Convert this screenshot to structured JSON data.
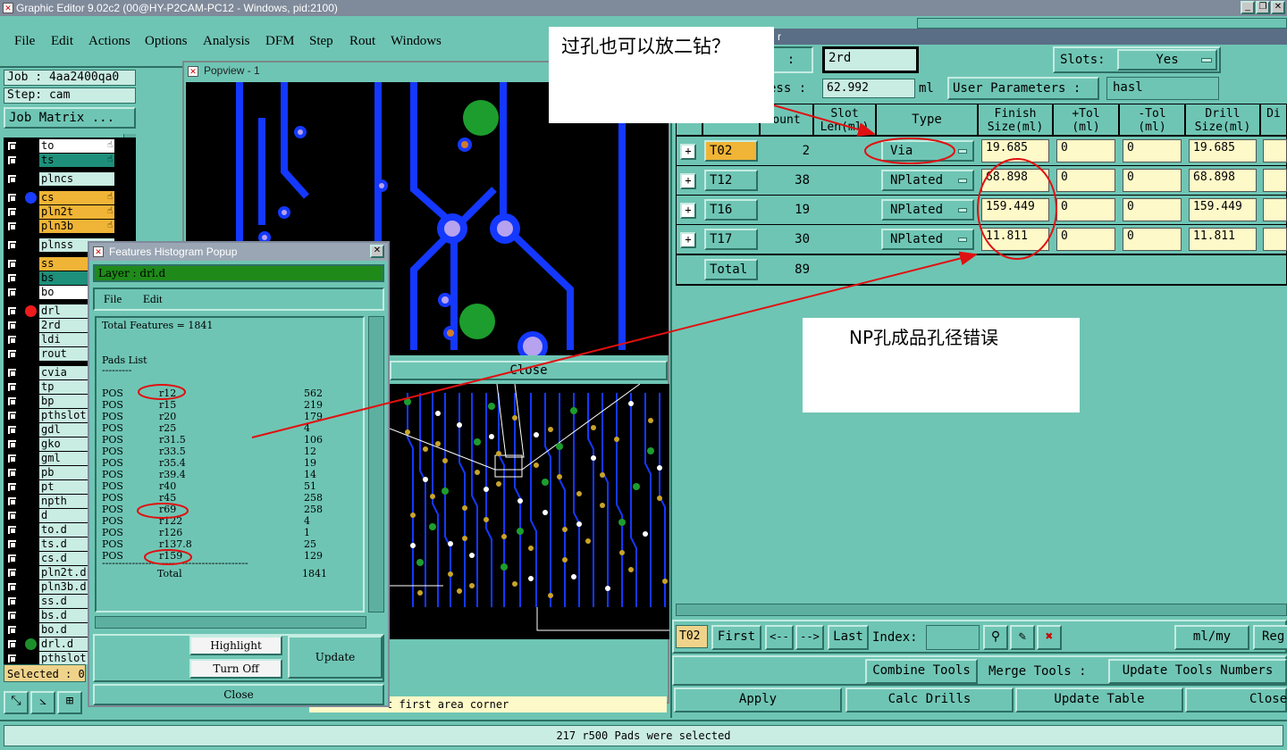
{
  "window": {
    "title": "Graphic Editor 9.02c2 (00@HY-P2CAM-PC12 - Windows, pid:2100)"
  },
  "menu": [
    "File",
    "Edit",
    "Actions",
    "Options",
    "Analysis",
    "DFM",
    "Step",
    "Rout",
    "Windows"
  ],
  "left_panel": {
    "job": "Job : 4aa2400qa0",
    "step": "Step: cam",
    "job_matrix": "Job Matrix ...",
    "selected": "Selected : 0"
  },
  "layers": [
    {
      "name": "to",
      "color": "#ffffff",
      "dot": "#000000",
      "hand": "☝"
    },
    {
      "name": "ts",
      "color": "#1d8f7a",
      "dot": "#000000",
      "hand": "☝"
    },
    {
      "name": "plncs",
      "color": "#c9ece3",
      "dot": "#000000",
      "hand": ""
    },
    {
      "name": "cs",
      "color": "#f0b436",
      "dot": "#1a3cff",
      "hand": "☝"
    },
    {
      "name": "pln2t",
      "color": "#f0b436",
      "dot": "#000000",
      "hand": "☝"
    },
    {
      "name": "pln3b",
      "color": "#f0b436",
      "dot": "#000000",
      "hand": "☝"
    },
    {
      "name": "plnss",
      "color": "#c9ece3",
      "dot": "#000000",
      "hand": ""
    },
    {
      "name": "ss",
      "color": "#f0b436",
      "dot": "#000000",
      "hand": ""
    },
    {
      "name": "bs",
      "color": "#1d8f7a",
      "dot": "#000000",
      "hand": ""
    },
    {
      "name": "bo",
      "color": "#ffffff",
      "dot": "#000000",
      "hand": ""
    },
    {
      "name": "drl",
      "color": "#c9ece3",
      "dot": "#ee1c1c",
      "hand": ""
    },
    {
      "name": "2rd",
      "color": "#c9ece3",
      "dot": "#000000",
      "hand": ""
    },
    {
      "name": "ldi",
      "color": "#c9ece3",
      "dot": "#000000",
      "hand": ""
    },
    {
      "name": "rout",
      "color": "#c9ece3",
      "dot": "#000000",
      "hand": ""
    },
    {
      "name": "cvia",
      "color": "#c9ece3",
      "dot": "#000000",
      "hand": ""
    },
    {
      "name": "tp",
      "color": "#c9ece3",
      "dot": "#000000",
      "hand": ""
    },
    {
      "name": "bp",
      "color": "#c9ece3",
      "dot": "#000000",
      "hand": ""
    },
    {
      "name": "pthslot",
      "color": "#c9ece3",
      "dot": "#000000",
      "hand": ""
    },
    {
      "name": "gdl",
      "color": "#c9ece3",
      "dot": "#000000",
      "hand": ""
    },
    {
      "name": "gko",
      "color": "#c9ece3",
      "dot": "#000000",
      "hand": ""
    },
    {
      "name": "gml",
      "color": "#c9ece3",
      "dot": "#000000",
      "hand": ""
    },
    {
      "name": "pb",
      "color": "#c9ece3",
      "dot": "#000000",
      "hand": ""
    },
    {
      "name": "pt",
      "color": "#c9ece3",
      "dot": "#000000",
      "hand": ""
    },
    {
      "name": "npth",
      "color": "#c9ece3",
      "dot": "#000000",
      "hand": ""
    },
    {
      "name": "d",
      "color": "#c9ece3",
      "dot": "#000000",
      "hand": ""
    },
    {
      "name": "to.d",
      "color": "#c9ece3",
      "dot": "#000000",
      "hand": ""
    },
    {
      "name": "ts.d",
      "color": "#c9ece3",
      "dot": "#000000",
      "hand": ""
    },
    {
      "name": "cs.d",
      "color": "#c9ece3",
      "dot": "#000000",
      "hand": ""
    },
    {
      "name": "pln2t.d",
      "color": "#c9ece3",
      "dot": "#000000",
      "hand": ""
    },
    {
      "name": "pln3b.d",
      "color": "#c9ece3",
      "dot": "#000000",
      "hand": ""
    },
    {
      "name": "ss.d",
      "color": "#c9ece3",
      "dot": "#000000",
      "hand": ""
    },
    {
      "name": "bs.d",
      "color": "#c9ece3",
      "dot": "#000000",
      "hand": ""
    },
    {
      "name": "bo.d",
      "color": "#c9ece3",
      "dot": "#000000",
      "hand": ""
    },
    {
      "name": "drl.d",
      "color": "#c9ece3",
      "dot": "#1d8f2a",
      "hand": ""
    },
    {
      "name": "pthslot.",
      "color": "#c9ece3",
      "dot": "#000000",
      "hand": ""
    }
  ],
  "popview": {
    "title": "Popview - 1",
    "close": "Close",
    "prompt": "t first area corner"
  },
  "histogram": {
    "title": "Features Histogram Popup",
    "layer": "Layer :  drl.d",
    "menu_file": "File",
    "menu_edit": "Edit",
    "total_features": "Total Features = 1841",
    "pads_list": "Pads List",
    "underline": "---------",
    "rows": [
      {
        "pol": "POS",
        "sym": "r12",
        "count": "562"
      },
      {
        "pol": "POS",
        "sym": "r15",
        "count": "219"
      },
      {
        "pol": "POS",
        "sym": "r20",
        "count": "179"
      },
      {
        "pol": "POS",
        "sym": "r25",
        "count": "4"
      },
      {
        "pol": "POS",
        "sym": "r31.5",
        "count": "106"
      },
      {
        "pol": "POS",
        "sym": "r33.5",
        "count": "12"
      },
      {
        "pol": "POS",
        "sym": "r35.4",
        "count": "19"
      },
      {
        "pol": "POS",
        "sym": "r39.4",
        "count": "14"
      },
      {
        "pol": "POS",
        "sym": "r40",
        "count": "51"
      },
      {
        "pol": "POS",
        "sym": "r45",
        "count": "258"
      },
      {
        "pol": "POS",
        "sym": "r69",
        "count": "258"
      },
      {
        "pol": "POS",
        "sym": "r122",
        "count": "4"
      },
      {
        "pol": "POS",
        "sym": "r126",
        "count": "1"
      },
      {
        "pol": "POS",
        "sym": "r137.8",
        "count": "25"
      },
      {
        "pol": "POS",
        "sym": "r159",
        "count": "129"
      }
    ],
    "total_label": "Total",
    "total_value": "1841",
    "highlight": "Highlight",
    "turn_off": "Turn Off",
    "update": "Update",
    "close": "Close"
  },
  "drill": {
    "title_suffix": "r",
    "colon": ":",
    "layer_value": "2rd",
    "thickness_label": "ess :",
    "thickness_value": "62.992",
    "thickness_unit": "ml",
    "slots_label": "Slots:",
    "slots_value": "Yes",
    "user_params_label": "User Parameters :",
    "user_params_value": "hasl",
    "headers": [
      "ount",
      "Slot\nLen(ml)",
      "Type",
      "Finish\nSize(ml)",
      "+Tol\n(ml)",
      "-Tol\n(ml)",
      "Drill\nSize(ml)",
      "Di\n"
    ],
    "rows": [
      {
        "tool": "T02",
        "count": "2",
        "type": "Via",
        "finish": "19.685",
        "ptol": "0",
        "mtol": "0",
        "drill": "19.685"
      },
      {
        "tool": "T12",
        "count": "38",
        "type": "NPlated",
        "finish": "68.898",
        "ptol": "0",
        "mtol": "0",
        "drill": "68.898"
      },
      {
        "tool": "T16",
        "count": "19",
        "type": "NPlated",
        "finish": "159.449",
        "ptol": "0",
        "mtol": "0",
        "drill": "159.449"
      },
      {
        "tool": "T17",
        "count": "30",
        "type": "NPlated",
        "finish": "11.811",
        "ptol": "0",
        "mtol": "0",
        "drill": "11.811"
      }
    ],
    "total_label": "Total",
    "total_count": "89",
    "current_tool": "T02",
    "first": "First",
    "prev": "<--",
    "next": "-->",
    "last": "Last",
    "index_label": "Index:",
    "units": "ml/my",
    "reg": "Reg",
    "combine": "Combine Tools",
    "merge": "Merge Tools :",
    "update_numbers": "Update Tools Numbers",
    "apply": "Apply",
    "calc": "Calc Drills",
    "update_table": "Update Table",
    "close": "Close"
  },
  "annotations": {
    "note1": "过孔也可以放二钻？",
    "note2": "NP孔成品孔径错误",
    "color": "#e01010"
  },
  "status": "217 r500 Pads were selected"
}
